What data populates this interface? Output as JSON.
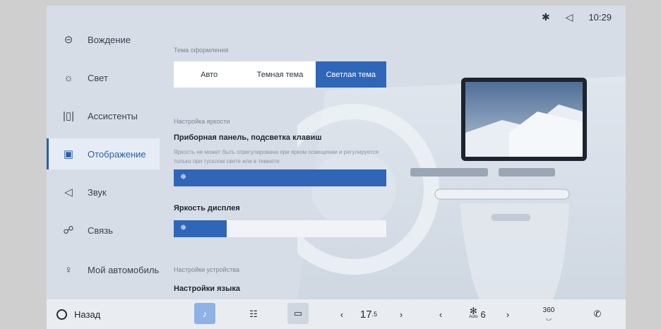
{
  "status": {
    "bluetooth_icon": "bluetooth-icon",
    "volume_icon": "volume-icon",
    "time": "10:29"
  },
  "sidebar": {
    "items": [
      {
        "label": "Вождение",
        "icon": "steering-wheel-icon"
      },
      {
        "label": "Свет",
        "icon": "light-icon"
      },
      {
        "label": "Ассистенты",
        "icon": "assistant-icon"
      },
      {
        "label": "Отображение",
        "icon": "display-icon",
        "active": true
      },
      {
        "label": "Звук",
        "icon": "speaker-icon"
      },
      {
        "label": "Связь",
        "icon": "link-icon"
      },
      {
        "label": "Мой автомобиль",
        "icon": "user-icon"
      }
    ]
  },
  "content": {
    "theme_section": "Тема оформления",
    "theme_options": [
      "Авто",
      "Темная тема",
      "Светлая тема"
    ],
    "theme_selected": "Светлая тема",
    "brightness_section": "Настройка яркости",
    "dashboard_title": "Приборная панель, подсветка клавиш",
    "dashboard_hint": "Яркость не может быть отрегулирована при ярком освещении и регулируется только при тусклом свете или в темноте",
    "dashboard_level": 1.0,
    "display_title": "Яркость дисплея",
    "display_level": 0.25,
    "device_section": "Настройки устройства",
    "language_title": "Настройки языка"
  },
  "bottombar": {
    "back_label": "Назад",
    "temp_value": "17",
    "temp_decimal": ".5",
    "fan_value": "6",
    "fan_auto": "Auto",
    "view360": "360",
    "colors": {
      "accent": "#2f66b8",
      "music_tile": "#8fb2e6"
    }
  }
}
